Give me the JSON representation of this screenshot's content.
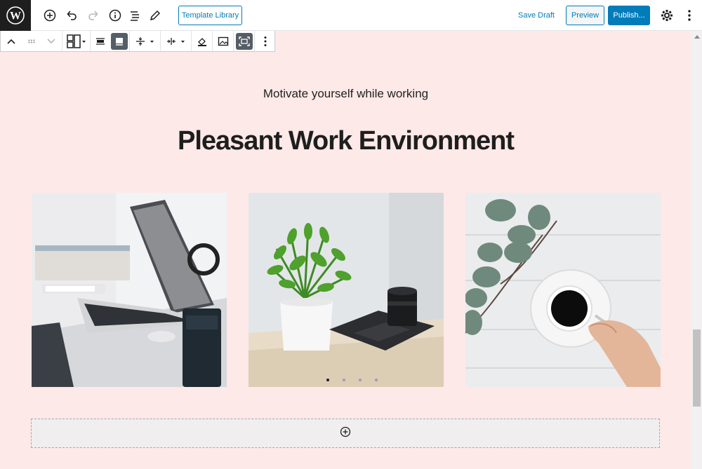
{
  "header": {
    "template_library": "Template Library",
    "save_draft": "Save Draft",
    "preview": "Preview",
    "publish": "Publish..."
  },
  "content": {
    "subtitle": "Motivate yourself while working",
    "title": "Pleasant Work Environment"
  },
  "gallery": {
    "images": [
      {
        "icon": "laptop-desk-photo"
      },
      {
        "icon": "plant-camera-photo"
      },
      {
        "icon": "coffee-cup-photo"
      }
    ],
    "dots_count": 4,
    "active_dot": 0
  },
  "colors": {
    "accent": "#007cba",
    "background": "#fde9e7",
    "dark": "#1e1e1e"
  }
}
